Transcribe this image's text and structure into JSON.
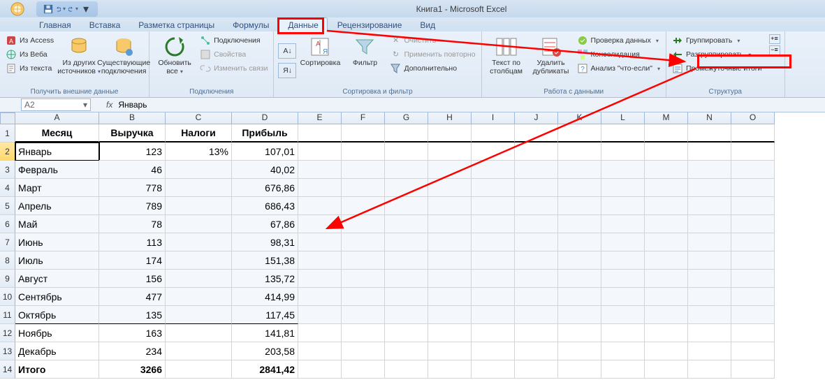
{
  "title": "Книга1 - Microsoft Excel",
  "qat": {
    "save": "save",
    "undo": "undo",
    "redo": "redo"
  },
  "tabs": [
    "Главная",
    "Вставка",
    "Разметка страницы",
    "Формулы",
    "Данные",
    "Рецензирование",
    "Вид"
  ],
  "active_tab": 4,
  "ribbon": {
    "g1": {
      "label": "Получить внешние данные",
      "access": "Из Access",
      "web": "Из Веба",
      "text": "Из текста",
      "other": "Из других источников",
      "existing": "Существующие подключения"
    },
    "g2": {
      "label": "Подключения",
      "refresh": "Обновить все",
      "conn": "Подключения",
      "props": "Свойства",
      "links": "Изменить связи"
    },
    "g3": {
      "label": "Сортировка и фильтр",
      "az": "А↓Я",
      "za": "Я↓А",
      "sort": "Сортировка",
      "filter": "Фильтр",
      "clear": "Очистить",
      "reapply": "Применить повторно",
      "adv": "Дополнительно"
    },
    "g4": {
      "label": "Работа с данными",
      "ttc": "Текст по столбцам",
      "dup": "Удалить дубликаты",
      "dv": "Проверка данных",
      "cons": "Консолидация",
      "whatif": "Анализ \"что-если\""
    },
    "g5": {
      "label": "Структура",
      "group": "Группировать",
      "ungroup": "Разгруппировать",
      "subtotal": "Промежуточные итоги"
    }
  },
  "namebox": "A2",
  "formula": "Январь",
  "fx_label": "fx",
  "columns": [
    "A",
    "B",
    "C",
    "D",
    "E",
    "F",
    "G",
    "H",
    "I",
    "J",
    "K",
    "L",
    "M",
    "N",
    "O"
  ],
  "header_row": [
    "Месяц",
    "Выручка",
    "Налоги",
    "Прибыль"
  ],
  "rows": [
    {
      "n": 1,
      "A": "Месяц",
      "B": "Выручка",
      "C": "Налоги",
      "D": "Прибыль",
      "hdr": true
    },
    {
      "n": 2,
      "A": "Январь",
      "B": "123",
      "C": "13%",
      "D": "107,01",
      "sel": true
    },
    {
      "n": 3,
      "A": "Февраль",
      "B": "46",
      "C": "",
      "D": "40,02",
      "shade": true
    },
    {
      "n": 4,
      "A": "Март",
      "B": "778",
      "C": "",
      "D": "676,86",
      "shade": true
    },
    {
      "n": 5,
      "A": "Апрель",
      "B": "789",
      "C": "",
      "D": "686,43",
      "shade": true
    },
    {
      "n": 6,
      "A": "Май",
      "B": "78",
      "C": "",
      "D": "67,86",
      "shade": true
    },
    {
      "n": 7,
      "A": "Июнь",
      "B": "113",
      "C": "",
      "D": "98,31",
      "shade": true
    },
    {
      "n": 8,
      "A": "Июль",
      "B": "174",
      "C": "",
      "D": "151,38",
      "shade": true
    },
    {
      "n": 9,
      "A": "Август",
      "B": "156",
      "C": "",
      "D": "135,72",
      "shade": true
    },
    {
      "n": 10,
      "A": "Сентябрь",
      "B": "477",
      "C": "",
      "D": "414,99",
      "shade": true
    },
    {
      "n": 11,
      "A": "Октябрь",
      "B": "135",
      "C": "",
      "D": "117,45",
      "shade": true,
      "obot": true
    },
    {
      "n": 12,
      "A": "Ноябрь",
      "B": "163",
      "C": "",
      "D": "141,81"
    },
    {
      "n": 13,
      "A": "Декабрь",
      "B": "234",
      "C": "",
      "D": "203,58"
    },
    {
      "n": 14,
      "A": "Итого",
      "B": "3266",
      "C": "",
      "D": "2841,42",
      "bold": true
    }
  ],
  "chart_data": {
    "type": "table",
    "title": "Книга1",
    "columns": [
      "Месяц",
      "Выручка",
      "Налоги",
      "Прибыль"
    ],
    "rows": [
      [
        "Январь",
        123,
        "13%",
        107.01
      ],
      [
        "Февраль",
        46,
        "",
        40.02
      ],
      [
        "Март",
        778,
        "",
        676.86
      ],
      [
        "Апрель",
        789,
        "",
        686.43
      ],
      [
        "Май",
        78,
        "",
        67.86
      ],
      [
        "Июнь",
        113,
        "",
        98.31
      ],
      [
        "Июль",
        174,
        "",
        151.38
      ],
      [
        "Август",
        156,
        "",
        135.72
      ],
      [
        "Сентябрь",
        477,
        "",
        414.99
      ],
      [
        "Октябрь",
        135,
        "",
        117.45
      ],
      [
        "Ноябрь",
        163,
        "",
        141.81
      ],
      [
        "Декабрь",
        234,
        "",
        203.58
      ],
      [
        "Итого",
        3266,
        "",
        2841.42
      ]
    ]
  }
}
